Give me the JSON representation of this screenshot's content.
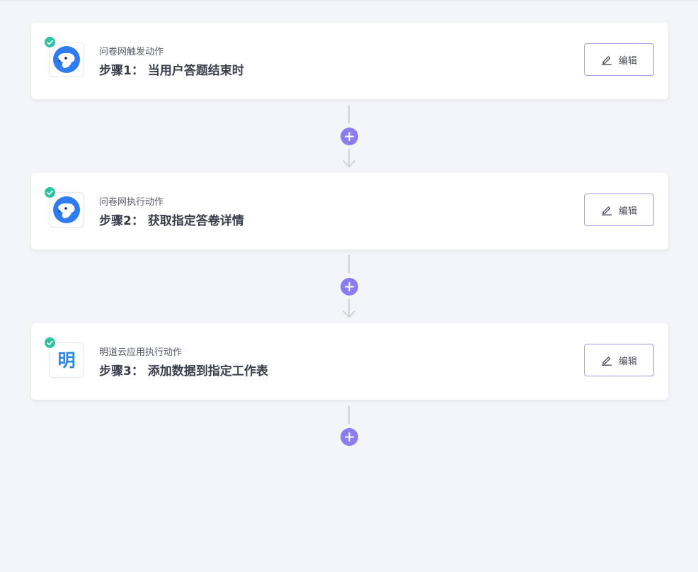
{
  "colors": {
    "page_background": "#f4f5f9",
    "success_check": "#2dc3a0",
    "add_button": "#8b7cf0",
    "edit_button_border": "#a79ee8",
    "connector_line": "#cfd2da",
    "wenjuan_brand": "#2f7bf0",
    "mingdao_brand": "#2a88e8"
  },
  "steps": [
    {
      "app_icon": "wenjuan-icon",
      "status_icon": "check-icon",
      "subtitle": "问卷网触发动作",
      "title": "步骤1： 当用户答题结束时",
      "edit_label": "编辑",
      "edit_icon": "pencil-icon"
    },
    {
      "app_icon": "wenjuan-icon",
      "status_icon": "check-icon",
      "subtitle": "问卷网执行动作",
      "title": "步骤2： 获取指定答卷详情",
      "edit_label": "编辑",
      "edit_icon": "pencil-icon"
    },
    {
      "app_icon": "mingdao-icon",
      "app_icon_glyph": "明",
      "status_icon": "check-icon",
      "subtitle": "明道云应用执行动作",
      "title": "步骤3： 添加数据到指定工作表",
      "edit_label": "编辑",
      "edit_icon": "pencil-icon"
    }
  ],
  "connectors": [
    {
      "add_icon": "plus-icon",
      "arrow_icon": "arrow-down-icon"
    },
    {
      "add_icon": "plus-icon",
      "arrow_icon": "arrow-down-icon"
    },
    {
      "add_icon": "plus-icon"
    }
  ]
}
